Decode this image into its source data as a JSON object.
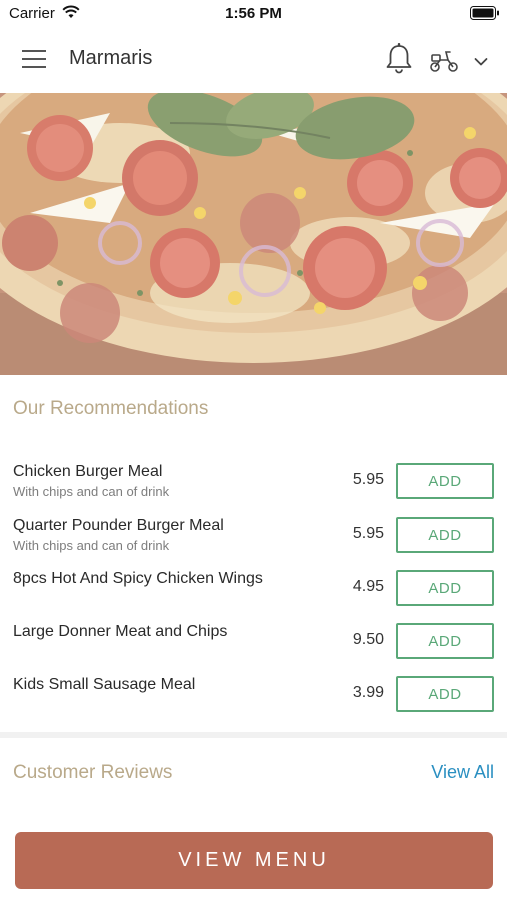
{
  "status_bar": {
    "carrier": "Carrier",
    "time": "1:56 PM"
  },
  "header": {
    "title": "Marmaris"
  },
  "recommendations": {
    "title": "Our Recommendations",
    "items": [
      {
        "name": "Chicken Burger Meal",
        "description": "With chips and can of drink",
        "price": "5.95",
        "button": "ADD"
      },
      {
        "name": "Quarter Pounder Burger Meal",
        "description": "With chips and can of drink",
        "price": "5.95",
        "button": "ADD"
      },
      {
        "name": "8pcs Hot And Spicy Chicken Wings",
        "description": "",
        "price": "4.95",
        "button": "ADD"
      },
      {
        "name": "Large Donner Meat and Chips",
        "description": "",
        "price": "9.50",
        "button": "ADD"
      },
      {
        "name": "Kids Small Sausage Meal",
        "description": "",
        "price": "3.99",
        "button": "ADD"
      }
    ]
  },
  "reviews": {
    "title": "Customer Reviews",
    "view_all": "View All"
  },
  "footer": {
    "view_menu": "VIEW MENU"
  },
  "colors": {
    "section_title": "#b9a98a",
    "add_green": "#5aa878",
    "link_blue": "#2a8fc1",
    "view_menu_bg": "#b86a55"
  },
  "icons": [
    "wifi-icon",
    "battery-icon",
    "hamburger-menu-icon",
    "bell-icon",
    "scooter-icon",
    "chevron-down-icon"
  ]
}
